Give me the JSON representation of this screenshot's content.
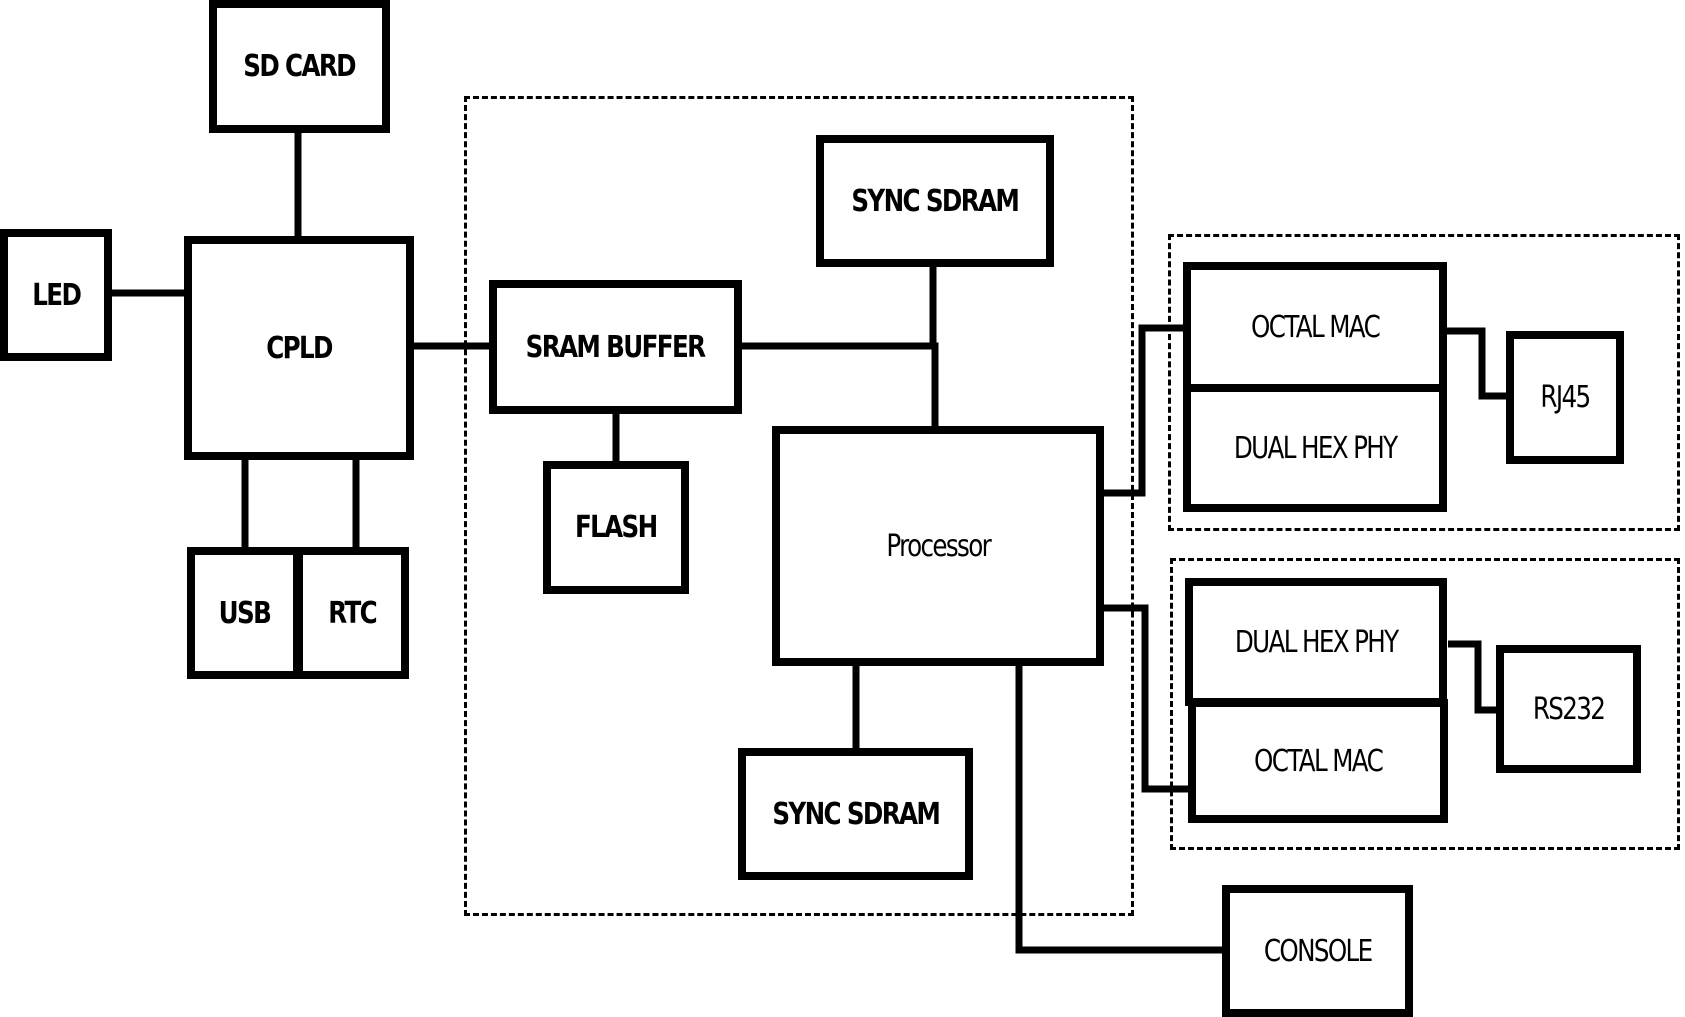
{
  "diagram": {
    "type": "hardware block diagram",
    "blocks": {
      "sd_card": "SD CARD",
      "led": "LED",
      "cpld": "CPLD",
      "usb": "USB",
      "rtc": "RTC",
      "sram_buffer": "SRAM BUFFER",
      "flash": "FLASH",
      "sync_sdram_top": "SYNC SDRAM",
      "processor": "Processor",
      "sync_sdram_bottom": "SYNC SDRAM",
      "octal_mac_1": "OCTAL MAC",
      "dual_hex_phy_1": "DUAL HEX PHY",
      "rj45": "RJ45",
      "dual_hex_phy_2": "DUAL HEX PHY",
      "octal_mac_2": "OCTAL MAC",
      "rs232": "RS232",
      "console": "CONSOLE"
    },
    "connections": [
      [
        "SD CARD",
        "CPLD"
      ],
      [
        "LED",
        "CPLD"
      ],
      [
        "CPLD",
        "USB"
      ],
      [
        "CPLD",
        "RTC"
      ],
      [
        "CPLD",
        "SRAM BUFFER"
      ],
      [
        "SRAM BUFFER",
        "FLASH"
      ],
      [
        "SRAM BUFFER",
        "Processor"
      ],
      [
        "SYNC SDRAM",
        "Processor"
      ],
      [
        "Processor",
        "SYNC SDRAM (bottom)"
      ],
      [
        "Processor",
        "OCTAL MAC (1)"
      ],
      [
        "Processor",
        "OCTAL MAC (2)"
      ],
      [
        "Processor",
        "CONSOLE"
      ],
      [
        "OCTAL MAC (1)",
        "RJ45"
      ],
      [
        "DUAL HEX PHY (2)",
        "RS232"
      ]
    ],
    "groups": [
      "processor-subsystem",
      "ethernet-module-1",
      "ethernet-module-2"
    ]
  }
}
